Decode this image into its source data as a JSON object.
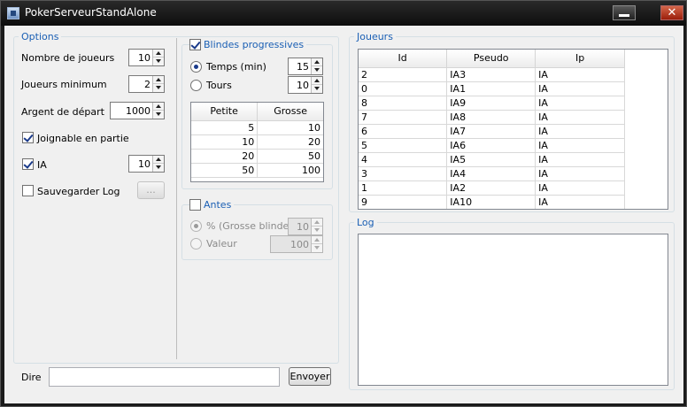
{
  "window": {
    "title": "PokerServeurStandAlone"
  },
  "options": {
    "group_title": "Options",
    "nb_players_label": "Nombre de joueurs",
    "nb_players_value": "10",
    "min_players_label": "Joueurs minimum",
    "min_players_value": "2",
    "starting_money_label": "Argent de départ",
    "starting_money_value": "1000",
    "joinable_label": "Joignable en partie",
    "joinable_checked": true,
    "ai_label": "IA",
    "ai_checked": true,
    "ai_value": "10",
    "save_log_label": "Sauvegarder Log",
    "save_log_checked": false,
    "browse_label": "..."
  },
  "blinds": {
    "group_title": "Blindes progressives",
    "enabled": true,
    "time_label": "Temps (min)",
    "time_value": "15",
    "time_selected": true,
    "turns_label": "Tours",
    "turns_value": "10",
    "columns": [
      "Petite",
      "Grosse"
    ],
    "rows": [
      [
        "5",
        "10"
      ],
      [
        "10",
        "20"
      ],
      [
        "20",
        "50"
      ],
      [
        "50",
        "100"
      ]
    ]
  },
  "antes": {
    "group_title": "Antes",
    "enabled": false,
    "percent_label": "% (Grosse blinde)",
    "percent_value": "10",
    "value_label": "Valeur",
    "value_value": "100"
  },
  "players": {
    "group_title": "Joueurs",
    "columns": [
      "Id",
      "Pseudo",
      "Ip"
    ],
    "rows": [
      [
        "2",
        "IA3",
        "IA"
      ],
      [
        "0",
        "IA1",
        "IA"
      ],
      [
        "8",
        "IA9",
        "IA"
      ],
      [
        "7",
        "IA8",
        "IA"
      ],
      [
        "6",
        "IA7",
        "IA"
      ],
      [
        "5",
        "IA6",
        "IA"
      ],
      [
        "4",
        "IA5",
        "IA"
      ],
      [
        "3",
        "IA4",
        "IA"
      ],
      [
        "1",
        "IA2",
        "IA"
      ],
      [
        "9",
        "IA10",
        "IA"
      ]
    ]
  },
  "log": {
    "group_title": "Log"
  },
  "chat": {
    "label": "Dire",
    "input_value": "",
    "send_label": "Envoyer"
  },
  "colors": {
    "group_title": "#1a5fb4",
    "titlebar": "#111111",
    "close_button": "#c0391f"
  },
  "icons": {
    "minimize": "minimize-icon",
    "close": "close-icon",
    "app": "app-icon"
  }
}
